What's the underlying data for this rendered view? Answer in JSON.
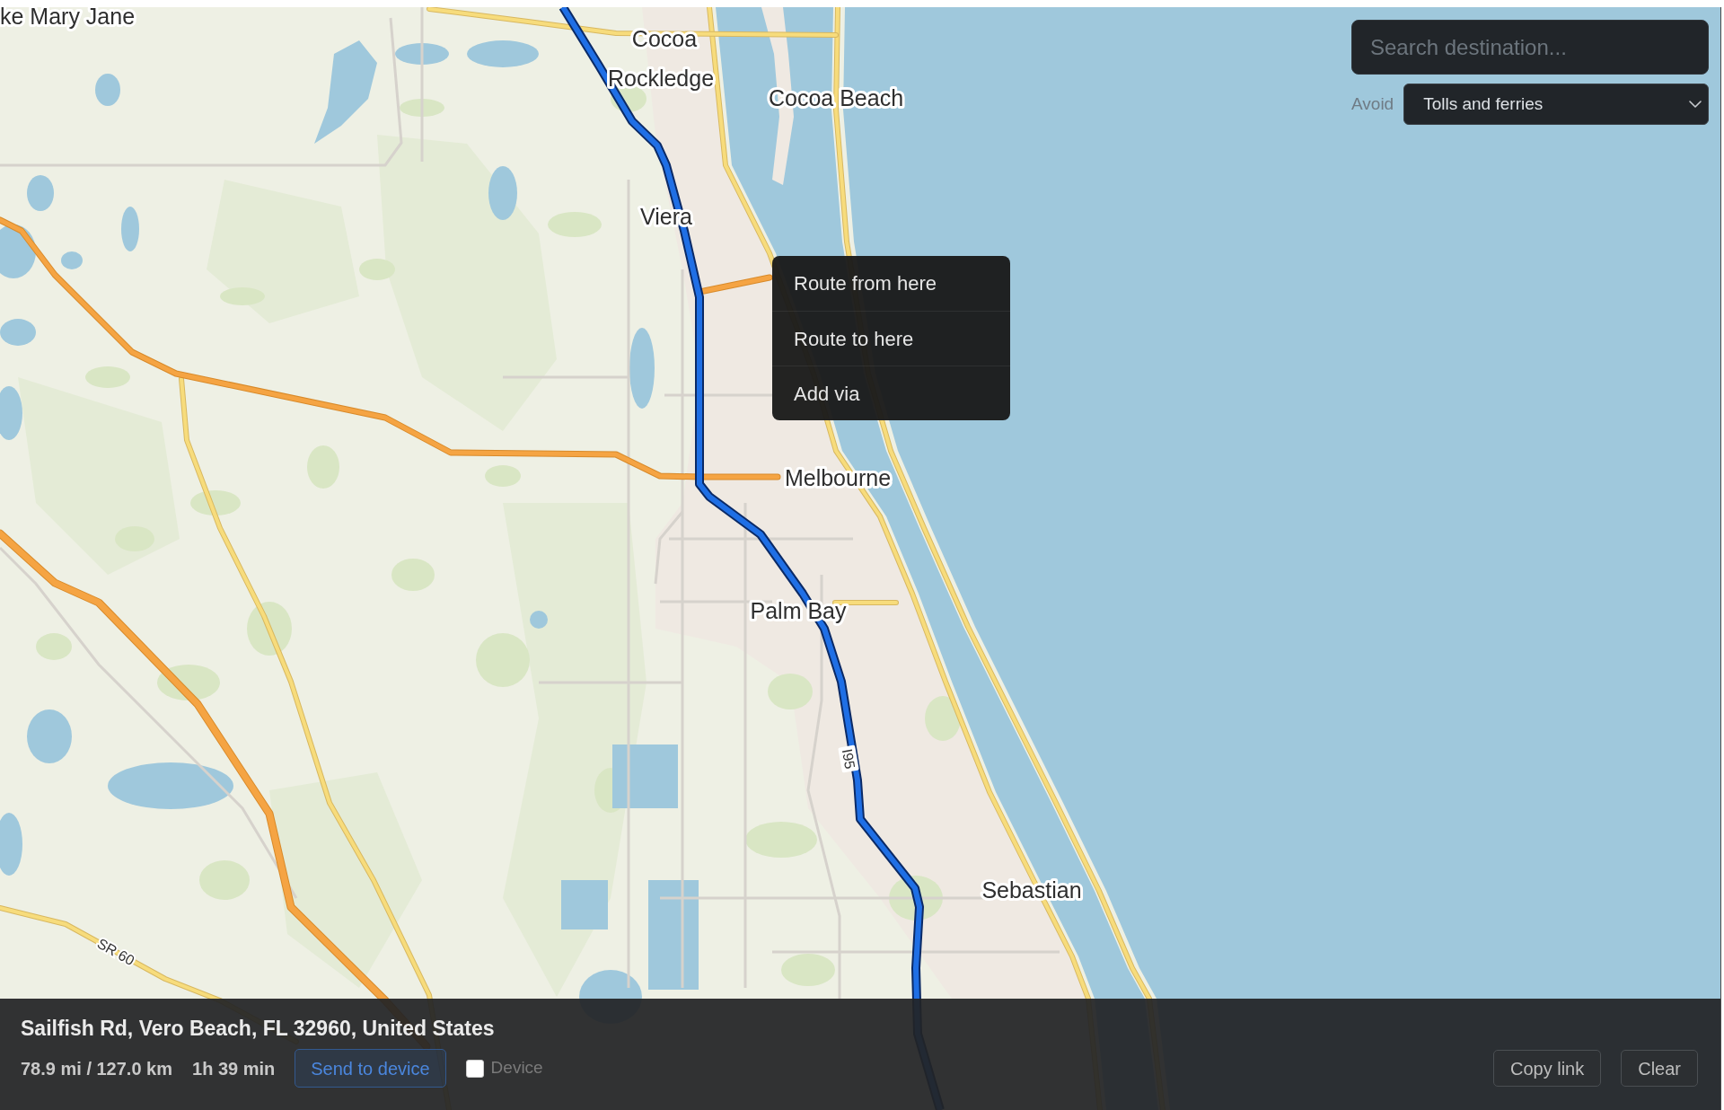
{
  "map": {
    "labels": [
      {
        "text": "ke Mary Jane",
        "kind": "place"
      },
      {
        "text": "Cocoa",
        "kind": "place"
      },
      {
        "text": "Rockledge",
        "kind": "place"
      },
      {
        "text": "Cocoa Beach",
        "kind": "place"
      },
      {
        "text": "Viera",
        "kind": "place"
      },
      {
        "text": "Melbourne",
        "kind": "place"
      },
      {
        "text": "Palm Bay",
        "kind": "place"
      },
      {
        "text": "I95",
        "kind": "highway"
      },
      {
        "text": "Sebastian",
        "kind": "place"
      },
      {
        "text": "SR 60",
        "kind": "road"
      }
    ]
  },
  "search": {
    "placeholder": "Search destination..."
  },
  "avoid": {
    "label": "Avoid",
    "value": "Tolls and ferries"
  },
  "context_menu": {
    "items": [
      "Route from here",
      "Route to here",
      "Add via"
    ]
  },
  "route_panel": {
    "address": "Sailfish Rd, Vero Beach, FL 32960, United States",
    "distance": "78.9 mi / 127.0 km",
    "duration": "1h 39 min",
    "send_button": "Send to device",
    "device_checkbox": {
      "label": "Device",
      "checked": false
    },
    "buttons": [
      "Copy link",
      "Clear"
    ]
  }
}
